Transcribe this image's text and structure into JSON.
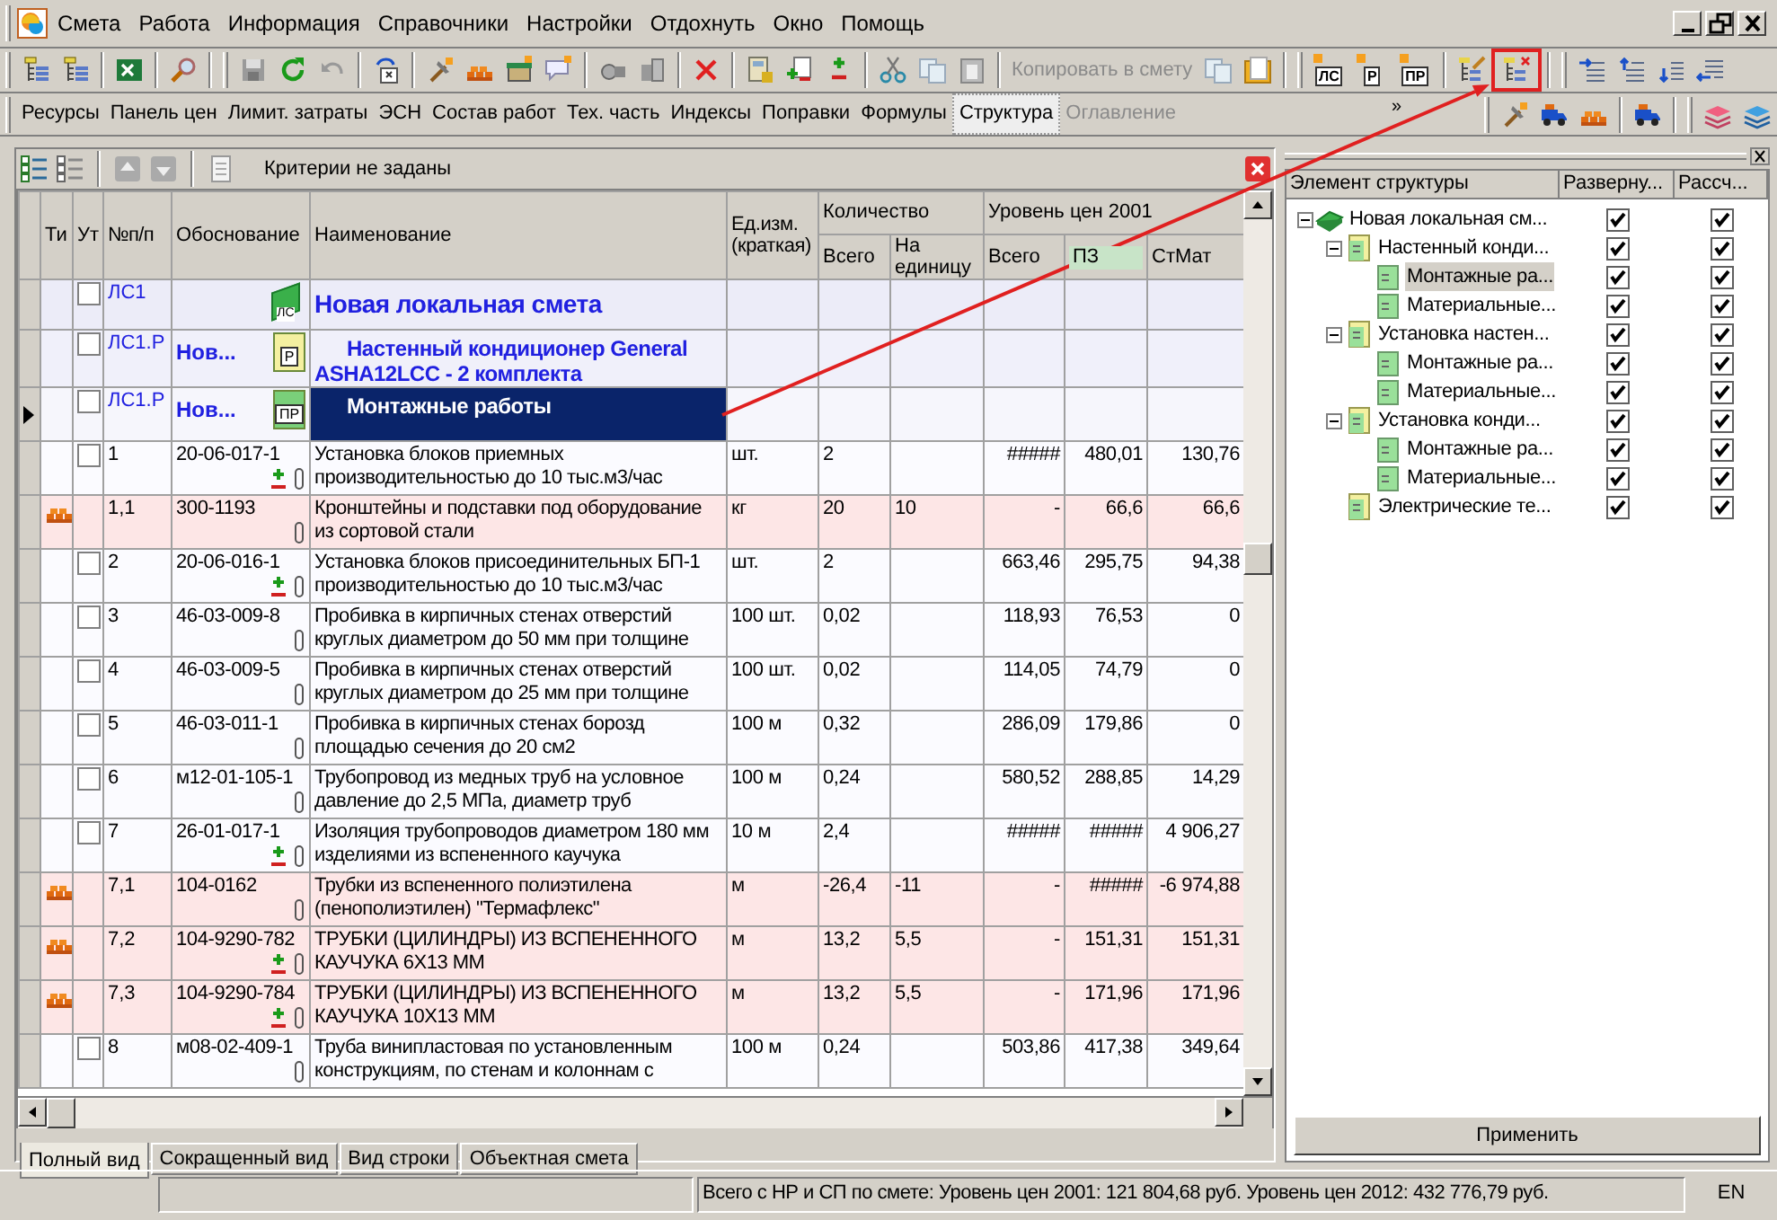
{
  "menu": [
    {
      "label": "Смета"
    },
    {
      "label": "Работа"
    },
    {
      "label": "Информация"
    },
    {
      "label": "Справочники"
    },
    {
      "label": "Настройки"
    },
    {
      "label": "Отдохнуть"
    },
    {
      "label": "Окно"
    },
    {
      "label": "Помощь"
    }
  ],
  "toolbar": {
    "copy_to_estimate": {
      "label": "Копировать в смету",
      "disabled": true
    },
    "doc_buttons": [
      "ЛС",
      "Р",
      "ПР"
    ]
  },
  "panels_bar": {
    "items": [
      {
        "label": "Ресурсы",
        "selected": false,
        "disabled": false
      },
      {
        "label": "Панель цен",
        "selected": false,
        "disabled": false
      },
      {
        "label": "Лимит. затраты",
        "selected": false,
        "disabled": false
      },
      {
        "label": "ЭСН",
        "selected": false,
        "disabled": false
      },
      {
        "label": "Состав работ",
        "selected": false,
        "disabled": false
      },
      {
        "label": "Тех. часть",
        "selected": false,
        "disabled": false
      },
      {
        "label": "Индексы",
        "selected": false,
        "disabled": false
      },
      {
        "label": "Поправки",
        "selected": false,
        "disabled": false
      },
      {
        "label": "Формулы",
        "selected": false,
        "disabled": false
      },
      {
        "label": "Структура",
        "selected": true,
        "disabled": false
      },
      {
        "label": "Оглавление",
        "selected": false,
        "disabled": true
      }
    ],
    "overflow": "»"
  },
  "filter_bar": {
    "text": "Критерии не заданы"
  },
  "table": {
    "columns": {
      "ti": "Ти",
      "ut": "Ут",
      "num": "№п/п",
      "code": "Обоснование",
      "name": "Наименование",
      "unit": "Ед.изм. (краткая)",
      "qty_group": "Количество",
      "qty_total": "Всего",
      "qty_per_unit": "На единицу",
      "price_group": "Уровень цен 2001",
      "price_total": "Всего",
      "pz": "ПЗ",
      "stmat": "СтМат"
    },
    "rows": [
      {
        "kind": "estimate",
        "selected": false,
        "marked": false,
        "num": "ЛС1",
        "code": "",
        "icon_text": "ЛС",
        "name": "Новая локальная смета"
      },
      {
        "kind": "section",
        "selected": false,
        "marked": false,
        "num": "ЛС1.Р",
        "code": "Нов...",
        "icon_text": "Р",
        "name": "Настенный кондиционер General ASHA12LCC - 2 комплекта"
      },
      {
        "kind": "subsection",
        "selected": true,
        "marked": false,
        "num": "ЛС1.Р",
        "code": "Нов...",
        "icon_text": "ПР",
        "name": "Монтажные работы"
      },
      {
        "kind": "work",
        "selected": false,
        "marked": false,
        "adjusted": true,
        "num": "1",
        "code": "20-06-017-1",
        "name": "Установка блоков приемных производительностью до 10 тыс.м3/час",
        "unit": "шт.",
        "qty_total": "2",
        "qty_per_unit": "",
        "price_total": "#####",
        "pz": "480,01",
        "stmat": "130,76"
      },
      {
        "kind": "resource",
        "selected": false,
        "adjusted": false,
        "num": "1,1",
        "code": "300-1193",
        "name": "Кронштейны и подставки под оборудование из сортовой стали",
        "unit": "кг",
        "qty_total": "20",
        "qty_per_unit": "10",
        "price_total": "-",
        "pz": "66,6",
        "stmat": "66,6"
      },
      {
        "kind": "work",
        "selected": false,
        "marked": false,
        "adjusted": true,
        "num": "2",
        "code": "20-06-016-1",
        "name": "Установка блоков присоединительных БП-1 производительностью до 10 тыс.м3/час",
        "unit": "шт.",
        "qty_total": "2",
        "qty_per_unit": "",
        "price_total": "663,46",
        "pz": "295,75",
        "stmat": "94,38"
      },
      {
        "kind": "work",
        "selected": false,
        "marked": false,
        "adjusted": false,
        "num": "3",
        "code": "46-03-009-8",
        "name": "Пробивка в кирпичных стенах отверстий круглых диаметром до 50 мм при толщине",
        "unit": "100 шт.",
        "qty_total": "0,02",
        "qty_per_unit": "",
        "price_total": "118,93",
        "pz": "76,53",
        "stmat": "0"
      },
      {
        "kind": "work",
        "selected": false,
        "marked": false,
        "adjusted": false,
        "num": "4",
        "code": "46-03-009-5",
        "name": "Пробивка в кирпичных стенах отверстий круглых диаметром до 25 мм при толщине",
        "unit": "100 шт.",
        "qty_total": "0,02",
        "qty_per_unit": "",
        "price_total": "114,05",
        "pz": "74,79",
        "stmat": "0"
      },
      {
        "kind": "work",
        "selected": false,
        "marked": false,
        "adjusted": false,
        "num": "5",
        "code": "46-03-011-1",
        "name": "Пробивка в кирпичных стенах борозд площадью сечения до 20 см2",
        "unit": "100 м",
        "qty_total": "0,32",
        "qty_per_unit": "",
        "price_total": "286,09",
        "pz": "179,86",
        "stmat": "0"
      },
      {
        "kind": "work",
        "selected": false,
        "marked": false,
        "adjusted": false,
        "num": "6",
        "code": "м12-01-105-1",
        "name": "Трубопровод из медных труб на условное давление до 2,5 МПа, диаметр труб",
        "unit": "100 м",
        "qty_total": "0,24",
        "qty_per_unit": "",
        "price_total": "580,52",
        "pz": "288,85",
        "stmat": "14,29"
      },
      {
        "kind": "work",
        "selected": false,
        "marked": false,
        "adjusted": true,
        "num": "7",
        "code": "26-01-017-1",
        "name": "Изоляция трубопроводов диаметром 180 мм изделиями из вспененного каучука",
        "unit": "10 м",
        "qty_total": "2,4",
        "qty_per_unit": "",
        "price_total": "#####",
        "pz": "#####",
        "stmat": "4 906,27"
      },
      {
        "kind": "resource",
        "selected": false,
        "adjusted": false,
        "num": "7,1",
        "code": "104-0162",
        "name": "Трубки из вспененного полиэтилена (пенополиэтилен) \"Термафлекс\"",
        "unit": "м",
        "qty_total": "-26,4",
        "qty_per_unit": "-11",
        "price_total": "-",
        "pz": "#####",
        "stmat": "-6 974,88"
      },
      {
        "kind": "resource",
        "selected": false,
        "adjusted": true,
        "num": "7,2",
        "code": "104-9290-782",
        "name": "ТРУБКИ (ЦИЛИНДРЫ) ИЗ ВСПЕНЕННОГО КАУЧУКА 6Х13 ММ",
        "unit": "м",
        "qty_total": "13,2",
        "qty_per_unit": "5,5",
        "price_total": "-",
        "pz": "151,31",
        "stmat": "151,31"
      },
      {
        "kind": "resource",
        "selected": false,
        "adjusted": true,
        "num": "7,3",
        "code": "104-9290-784",
        "name": "ТРУБКИ (ЦИЛИНДРЫ) ИЗ ВСПЕНЕННОГО КАУЧУКА 10Х13 ММ",
        "unit": "м",
        "qty_total": "13,2",
        "qty_per_unit": "5,5",
        "price_total": "-",
        "pz": "171,96",
        "stmat": "171,96"
      },
      {
        "kind": "work",
        "selected": false,
        "marked": false,
        "adjusted": false,
        "num": "8",
        "code": "м08-02-409-1",
        "name": "Труба винипластовая по установленным конструкциям, по стенам и колоннам с",
        "unit": "100 м",
        "qty_total": "0,24",
        "qty_per_unit": "",
        "price_total": "503,86",
        "pz": "417,38",
        "stmat": "349,64"
      }
    ]
  },
  "view_tabs": [
    {
      "label": "Полный вид",
      "selected": true
    },
    {
      "label": "Сокращенный вид",
      "selected": false
    },
    {
      "label": "Вид строки",
      "selected": false
    },
    {
      "label": "Объектная смета",
      "selected": false
    }
  ],
  "structure_panel": {
    "columns": [
      "Элемент структуры",
      "Разверну...",
      "Рассч..."
    ],
    "tree": [
      {
        "label": "Новая локальная см...",
        "kind": "estimate",
        "expanded": true,
        "selected": false,
        "unfolded": true,
        "calculated": true,
        "children": [
          {
            "label": "Настенный конди...",
            "kind": "section",
            "expanded": true,
            "selected": false,
            "unfolded": true,
            "calculated": true,
            "children": [
              {
                "label": "Монтажные ра...",
                "kind": "subsection",
                "expanded": false,
                "selected": true,
                "unfolded": true,
                "calculated": true
              },
              {
                "label": "Материальные...",
                "kind": "subsection",
                "expanded": false,
                "selected": false,
                "unfolded": true,
                "calculated": true
              }
            ]
          },
          {
            "label": "Установка настен...",
            "kind": "section",
            "expanded": true,
            "selected": false,
            "unfolded": true,
            "calculated": true,
            "children": [
              {
                "label": "Монтажные ра...",
                "kind": "subsection",
                "expanded": false,
                "selected": false,
                "unfolded": true,
                "calculated": true
              },
              {
                "label": "Материальные...",
                "kind": "subsection",
                "expanded": false,
                "selected": false,
                "unfolded": true,
                "calculated": true
              }
            ]
          },
          {
            "label": "Установка конди...",
            "kind": "section",
            "expanded": true,
            "selected": false,
            "unfolded": true,
            "calculated": true,
            "children": [
              {
                "label": "Монтажные ра...",
                "kind": "subsection",
                "expanded": false,
                "selected": false,
                "unfolded": true,
                "calculated": true
              },
              {
                "label": "Материальные...",
                "kind": "subsection",
                "expanded": false,
                "selected": false,
                "unfolded": true,
                "calculated": true
              }
            ]
          },
          {
            "label": "Электрические те...",
            "kind": "section",
            "expanded": false,
            "selected": false,
            "unfolded": true,
            "calculated": true
          }
        ]
      }
    ],
    "apply_button": "Применить"
  },
  "status_bar": {
    "total": "Всего с НР и СП по смете: Уровень цен 2001: 121 804,68 руб. Уровень цен 2012: 432 776,79 руб.",
    "language": "EN"
  }
}
